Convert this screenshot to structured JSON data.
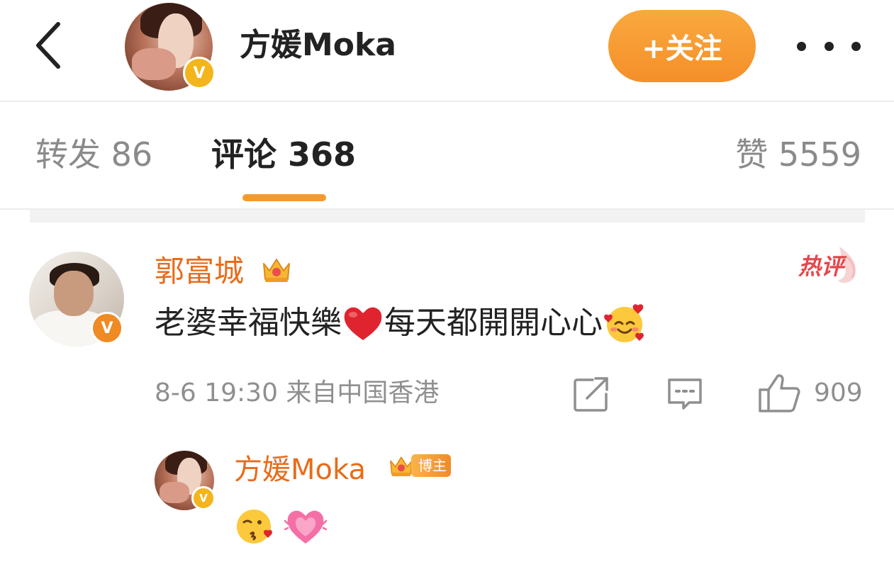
{
  "header": {
    "name": "方媛Moka",
    "follow_label": "+关注"
  },
  "tabs": [
    {
      "label": "转发 86"
    },
    {
      "label": "评论 368"
    },
    {
      "label": "赞 5559"
    }
  ],
  "comment": {
    "author": "郭富城",
    "hot_badge": "热评",
    "text_part1": "老婆幸福快樂",
    "text_part2": "每天都開開心心",
    "meta": "8-6 19:30 来自中国香港",
    "like_count": "909",
    "reply": {
      "author": "方媛Moka",
      "poster_tag": "博主"
    }
  },
  "colors": {
    "accent_orange": "#f58f29",
    "username_orange": "#e86b19",
    "hot_red": "#e5474b",
    "verified_gold": "#f3b51b"
  },
  "icons": {
    "back": "chevron-left-icon",
    "more": "more-dots-icon",
    "crown": "crown-icon",
    "share": "share-icon",
    "reply": "comment-icon",
    "like": "thumbs-up-icon",
    "heart_emoji": "red-heart-emoji",
    "smile_emoji": "smiling-face-with-hearts-emoji",
    "kiss_emoji": "face-blowing-kiss-emoji",
    "pink_heart_emoji": "growing-heart-emoji"
  }
}
